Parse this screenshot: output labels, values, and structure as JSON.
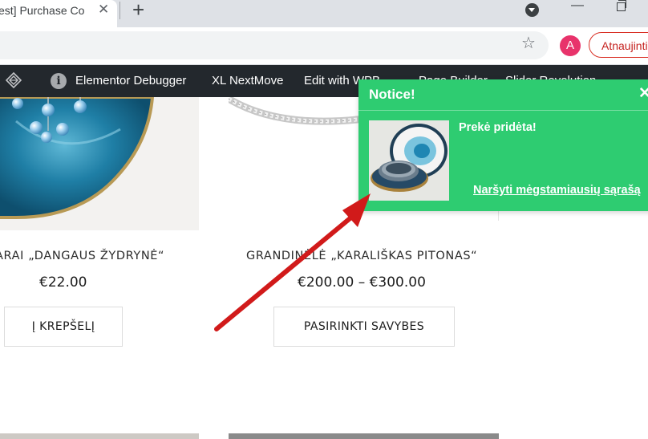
{
  "browser": {
    "tab_title": "est] Purchase Co",
    "tab_close": "✕",
    "new_tab": "+",
    "minimize": "—",
    "profile_initial": "A",
    "update_button": "Atnaujinti"
  },
  "admin_bar": {
    "items": [
      "Elementor Debugger",
      "XL NextMove",
      "Edit with WPB",
      "Page Builder",
      "Slider Revolution"
    ]
  },
  "products": [
    {
      "title": "ARAI „DANGAUS ŽYDRYNĖ“",
      "price": "€22.00",
      "button": "Į KREPŠELĮ"
    },
    {
      "title": "GRANDINĖLĖ „KARALIŠKAS PITONAS“",
      "price": "€200.00 – €300.00",
      "button": "PASIRINKTI SAVYBES"
    }
  ],
  "notice": {
    "title": "Notice!",
    "close": "✕",
    "message": "Prekė pridėta!",
    "link": "Naršyti mėgstamiausių sąrašą"
  },
  "colors": {
    "notice_bg": "#2ecc71",
    "admin_bar_bg": "#23282d",
    "arrow": "#d11a1a",
    "update_button_border": "#d93025"
  },
  "icons": [
    "close-icon",
    "plus-icon",
    "profile-dropdown-icon",
    "minimize-icon",
    "restore-icon",
    "star-icon",
    "avatar",
    "wp-logo-icon",
    "info-icon",
    "notice-close-icon",
    "annotation-arrow"
  ]
}
